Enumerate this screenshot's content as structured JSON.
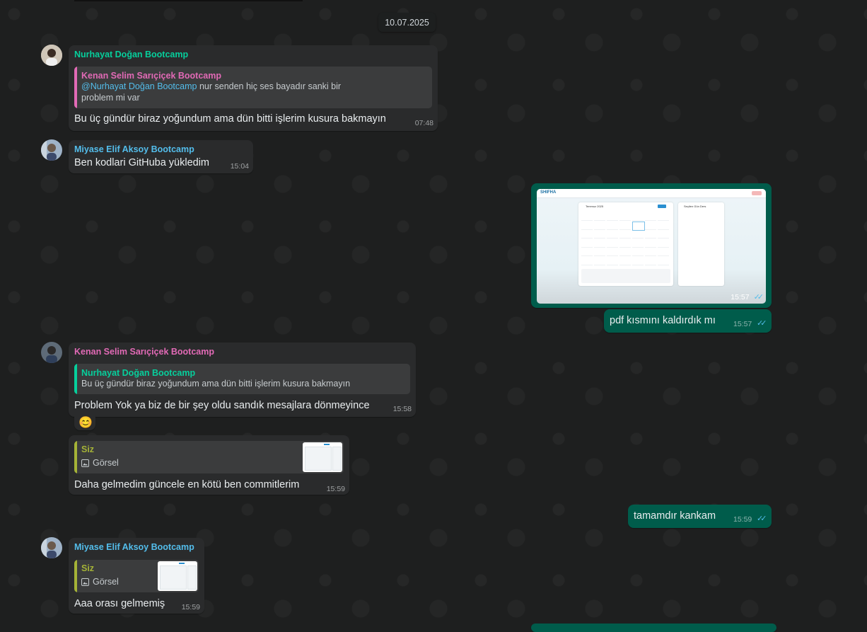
{
  "date_chip": "10.07.2025",
  "messages": {
    "m1": {
      "sender": "Nurhayat Doğan Bootcamp",
      "quote_sender": "Kenan Selim Sarıçiçek Bootcamp",
      "quote_mention": "@Nurhayat Doğan Bootcamp",
      "quote_text_1": " nur senden hiç ses bayadır sanki bir",
      "quote_text_2": "problem mi var",
      "text": "Bu üç gündür biraz yoğundum ama dün bitti işlerim kusura bakmayın",
      "time": "07:48"
    },
    "m2": {
      "sender": "Miyase Elif Aksoy Bootcamp",
      "text": "Ben kodlari GitHuba yükledim",
      "time": "15:04"
    },
    "m3": {
      "image_brand": "SHIFHA",
      "image_heading": "Temmuz 2025",
      "image_side": "Seçilen Gün Ders",
      "time": "15:57"
    },
    "m4": {
      "text": "pdf kısmını kaldırdık mı",
      "time": "15:57"
    },
    "m5": {
      "sender": "Kenan Selim Sarıçiçek Bootcamp",
      "quote_sender": "Nurhayat Doğan Bootcamp",
      "quote_text": "Bu üç gündür biraz yoğundum ama dün bitti işlerim kusura bakmayın",
      "text": "Problem Yok ya biz de bir şey oldu sandık mesajlara dönmeyince",
      "emoji": "😊",
      "time": "15:58"
    },
    "m6": {
      "quote_sender": "Siz",
      "quote_text": "Görsel",
      "text": "Daha gelmedim güncele en kötü ben commitlerim",
      "time": "15:59"
    },
    "m7": {
      "text": "tamamdır kankam",
      "time": "15:59"
    },
    "m8": {
      "sender": "Miyase Elif Aksoy Bootcamp",
      "quote_sender": "Siz",
      "quote_text": "Görsel",
      "text": "Aaa orası gelmemiş",
      "time": "15:59"
    }
  },
  "colors": {
    "incoming_bubble": "#2a2b2c",
    "outgoing_bubble": "#005c4b",
    "name_green": "#06cf9c",
    "name_pink": "#e26ab6",
    "name_blue": "#53bdeb",
    "quote_olive": "#a5b337",
    "read_ticks": "#53bdeb"
  }
}
